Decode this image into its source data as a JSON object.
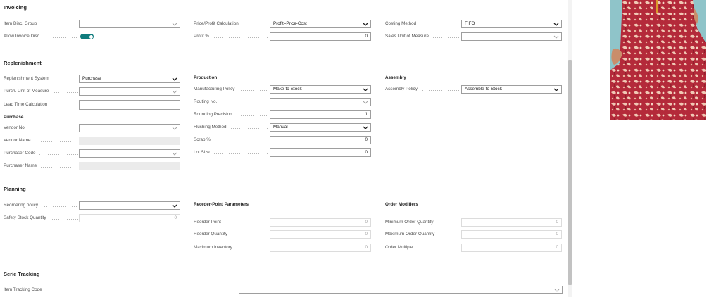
{
  "invoicing": {
    "title": "Invoicing",
    "item_disc_group": {
      "label": "Item Disc. Group",
      "value": ""
    },
    "allow_invoice_disc": {
      "label": "Allow Invoice Disc.",
      "on": true
    },
    "price_profit_calc": {
      "label": "Price/Profit Calculation",
      "value": "Profit=Price-Cost"
    },
    "profit_pct": {
      "label": "Profit %",
      "value": "0"
    },
    "costing_method": {
      "label": "Costing Method",
      "value": "FIFO"
    },
    "sales_uom": {
      "label": "Sales Unit of Measure",
      "value": ""
    }
  },
  "replenishment": {
    "title": "Replenishment",
    "system": {
      "label": "Replenishment System",
      "value": "Purchase"
    },
    "purch_uom": {
      "label": "Purch. Unit of Measure",
      "value": ""
    },
    "lead_time": {
      "label": "Lead Time Calculation",
      "value": ""
    },
    "purchase_heading": "Purchase",
    "vendor_no": {
      "label": "Vendor No.",
      "value": ""
    },
    "vendor_name": {
      "label": "Vendor Name",
      "value": ""
    },
    "purchaser_code": {
      "label": "Purchaser Code",
      "value": ""
    },
    "purchaser_name": {
      "label": "Purchaser Name",
      "value": ""
    },
    "production_heading": "Production",
    "manufacturing_policy": {
      "label": "Manufacturing Policy",
      "value": "Make-to-Stock"
    },
    "routing_no": {
      "label": "Routing No.",
      "value": ""
    },
    "rounding_precision": {
      "label": "Rounding Precision",
      "value": "1"
    },
    "flushing_method": {
      "label": "Flushing Method",
      "value": "Manual"
    },
    "scrap_pct": {
      "label": "Scrap %",
      "value": "0"
    },
    "lot_size": {
      "label": "Lot Size",
      "value": "0"
    },
    "assembly_heading": "Assembly",
    "assembly_policy": {
      "label": "Assembly Policy",
      "value": "Assemble-to-Stock"
    }
  },
  "planning": {
    "title": "Planning",
    "reordering_policy": {
      "label": "Reordering policy",
      "value": ""
    },
    "safety_stock": {
      "label": "Safety Stock Quantity",
      "value": "0"
    },
    "reorder_point_heading": "Reorder-Point Parameters",
    "reorder_point": {
      "label": "Reorder Point",
      "value": "0"
    },
    "reorder_quantity": {
      "label": "Reorder Quantity",
      "value": "0"
    },
    "maximum_inventory": {
      "label": "Maximum Inventory",
      "value": "0"
    },
    "order_modifiers_heading": "Order Modifiers",
    "min_order_qty": {
      "label": "Minimum Order Quantity",
      "value": "0"
    },
    "max_order_qty": {
      "label": "Maximum Order Quantity",
      "value": "0"
    },
    "order_multiple": {
      "label": "Order Multiple",
      "value": "0"
    }
  },
  "serie_tracking": {
    "title": "Serie Tracking",
    "item_tracking_code": {
      "label": "Item Tracking Code",
      "value": ""
    }
  },
  "colors": {
    "accent": "#0f7c7d",
    "photo_primary": "#b42a3a",
    "photo_secondary": "#f0c8b4"
  }
}
